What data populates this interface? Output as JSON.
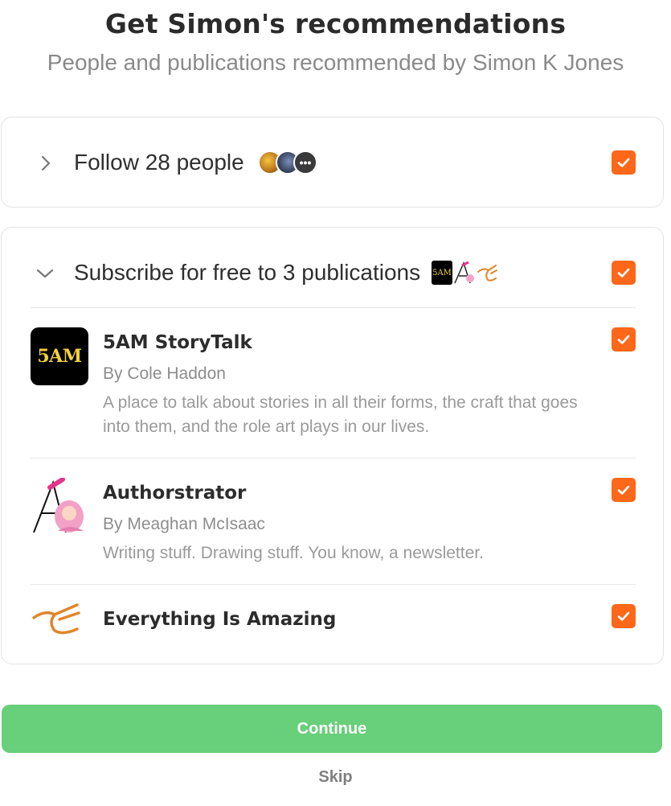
{
  "header": {
    "title": "Get Simon's recommendations",
    "subtitle": "People and publications recommended by Simon K Jones"
  },
  "people": {
    "label": "Follow 28 people",
    "more_glyph": "•••",
    "checked": true,
    "chevron_icon": "chevron-right-icon"
  },
  "publications": {
    "label": "Subscribe for free to 3 publications",
    "checked": true,
    "chevron_icon": "chevron-down-icon",
    "mini_logo_text": "5AM",
    "items": [
      {
        "logo_text": "5AM",
        "name": "5AM StoryTalk",
        "author": "By Cole Haddon",
        "description": "A place to talk about stories in all their forms, the craft that goes into them, and the role art plays in our lives.",
        "checked": true
      },
      {
        "name": "Authorstrator",
        "author": "By Meaghan McIsaac",
        "description": "Writing stuff. Drawing stuff. You know, a newsletter.",
        "checked": true
      },
      {
        "name": "Everything Is Amazing",
        "checked": true
      }
    ]
  },
  "actions": {
    "continue_label": "Continue",
    "skip_label": "Skip"
  },
  "colors": {
    "accent": "#ff6719",
    "continue_bg": "#68cf7a"
  }
}
